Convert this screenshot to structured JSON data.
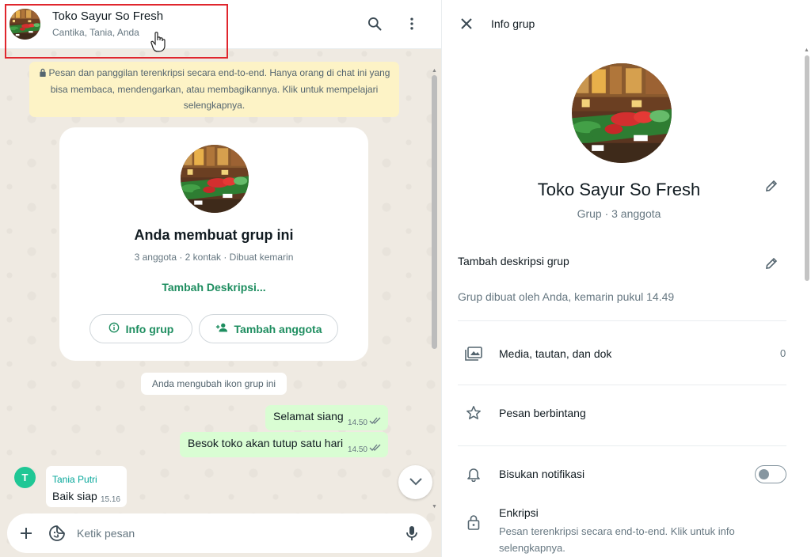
{
  "chat_header": {
    "title": "Toko Sayur So Fresh",
    "members": "Cantika, Tania, Anda",
    "search_icon": "search-icon",
    "menu_icon": "kebab-menu-icon"
  },
  "encryption_notice": {
    "text": "Pesan dan panggilan terenkripsi secara end-to-end. Hanya orang di chat ini yang bisa membaca, mendengarkan, atau membagikannya. Klik untuk mempelajari selengkapnya."
  },
  "group_card": {
    "title": "Anda membuat grup ini",
    "subtitle": "3 anggota · 2 kontak · Dibuat kemarin",
    "add_description": "Tambah Deskripsi...",
    "info_button": "Info grup",
    "add_member_button": "Tambah anggota"
  },
  "system_message": "Anda mengubah ikon grup ini",
  "outgoing_messages": [
    {
      "text": "Selamat siang",
      "time": "14.50"
    },
    {
      "text": "Besok toko akan tutup satu hari",
      "time": "14.50"
    }
  ],
  "incoming_message": {
    "avatar_initial": "T",
    "sender": "Tania Putri",
    "text": "Baik siap",
    "time": "15.16"
  },
  "composer": {
    "placeholder": "Ketik pesan"
  },
  "info_panel": {
    "title": "Info grup",
    "group_name": "Toko Sayur So Fresh",
    "group_meta": "Grup · 3 anggota",
    "description_prompt": "Tambah deskripsi grup",
    "created_text": "Grup dibuat oleh Anda, kemarin pukul 14.49",
    "media_label": "Media, tautan, dan dok",
    "media_count": "0",
    "starred_label": "Pesan berbintang",
    "mute_label": "Bisukan notifikasi",
    "mute_enabled": false,
    "encryption_label": "Enkripsi",
    "encryption_desc": "Pesan terenkripsi secara end-to-end. Klik untuk info selengkapnya."
  },
  "colors": {
    "accent_green": "#1d8d5f",
    "bubble_out": "#d9fdd3",
    "notice_bg": "#fdf3c6",
    "chat_bg": "#efeae2",
    "highlight_red": "#e0262d"
  }
}
